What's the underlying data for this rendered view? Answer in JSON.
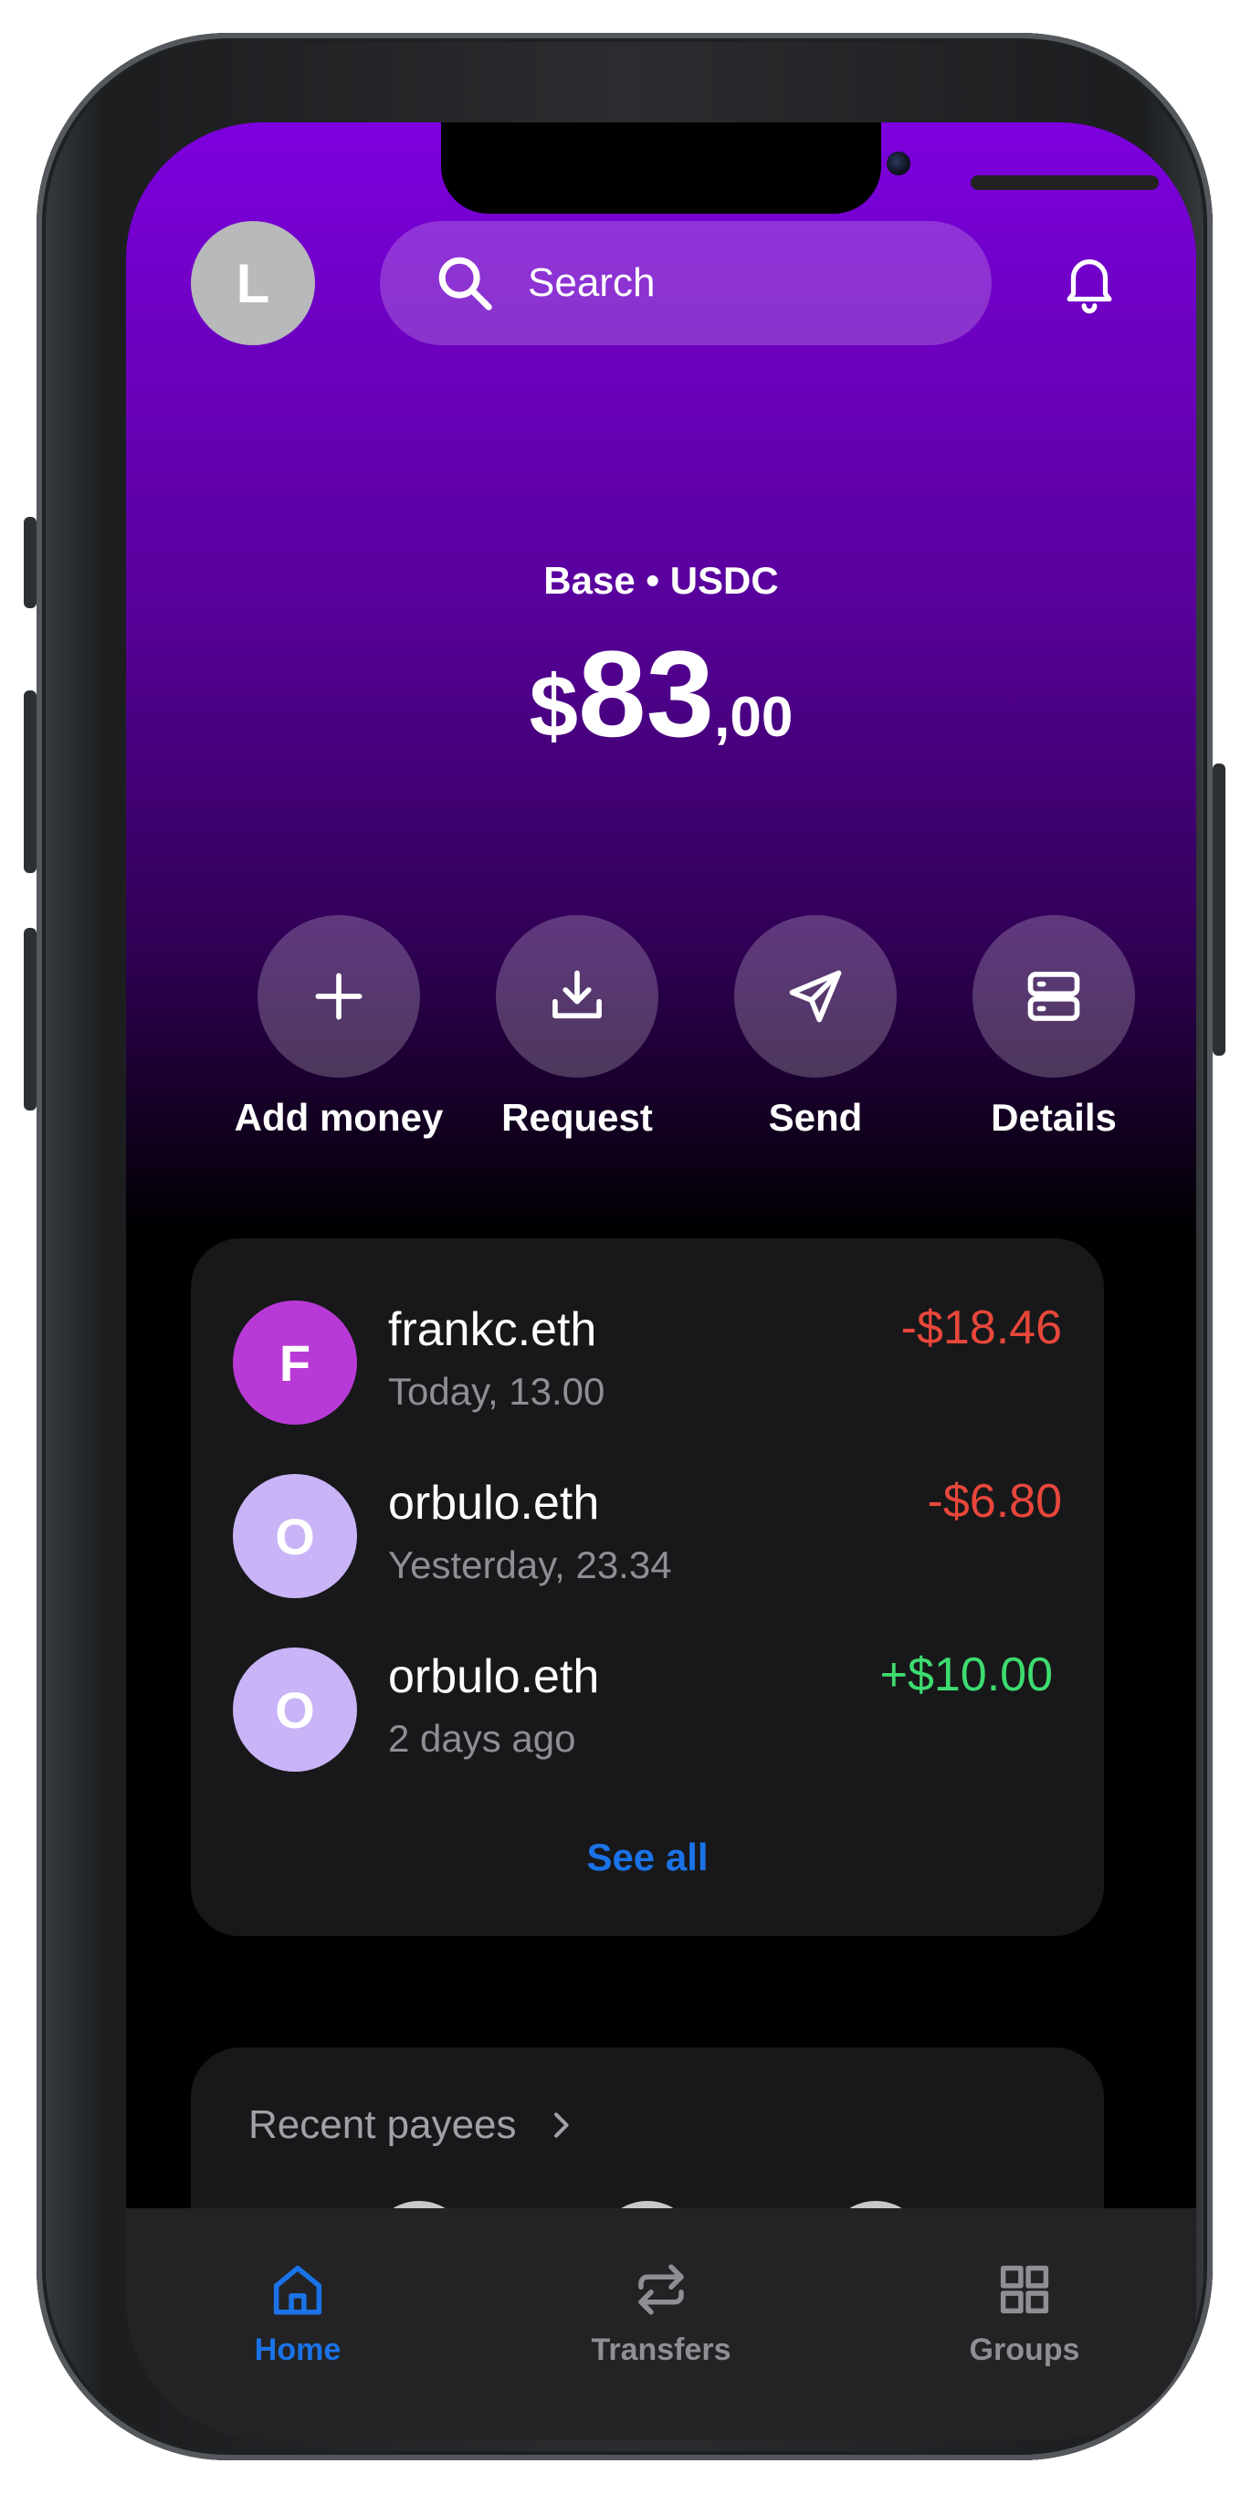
{
  "header": {
    "avatar_initial": "L",
    "search_placeholder": "Search"
  },
  "balance": {
    "network_label": "Base • USDC",
    "currency_symbol": "$",
    "integer": "83",
    "decimal": ",00"
  },
  "actions": [
    {
      "label": "Add money",
      "icon": "plus-icon"
    },
    {
      "label": "Request",
      "icon": "download-icon"
    },
    {
      "label": "Send",
      "icon": "send-icon"
    },
    {
      "label": "Details",
      "icon": "server-icon"
    }
  ],
  "transactions": [
    {
      "initial": "F",
      "name": "frankc.eth",
      "time": "Today, 13.00",
      "amount": "-$18.46",
      "avatar_color": "#b83ad6",
      "amount_color": "#e8473b"
    },
    {
      "initial": "O",
      "name": "orbulo.eth",
      "time": "Yesterday, 23.34",
      "amount": "-$6.80",
      "avatar_color": "#c8b4f6",
      "amount_color": "#e8473b"
    },
    {
      "initial": "O",
      "name": "orbulo.eth",
      "time": "2 days ago",
      "amount": "+$10.00",
      "avatar_color": "#c8b4f6",
      "amount_color": "#3ddc6f"
    }
  ],
  "see_all_label": "See all",
  "recent_payees": {
    "title": "Recent payees"
  },
  "tabbar": {
    "tabs": [
      {
        "label": "Home",
        "icon": "home-icon",
        "active": true
      },
      {
        "label": "Transfers",
        "icon": "transfer-icon",
        "active": false
      },
      {
        "label": "Groups",
        "icon": "grid-icon",
        "active": false
      }
    ]
  },
  "colors": {
    "accent": "#1a73e8",
    "gradient_top": "#7d00de",
    "negative": "#e8473b",
    "positive": "#3ddc6f"
  }
}
